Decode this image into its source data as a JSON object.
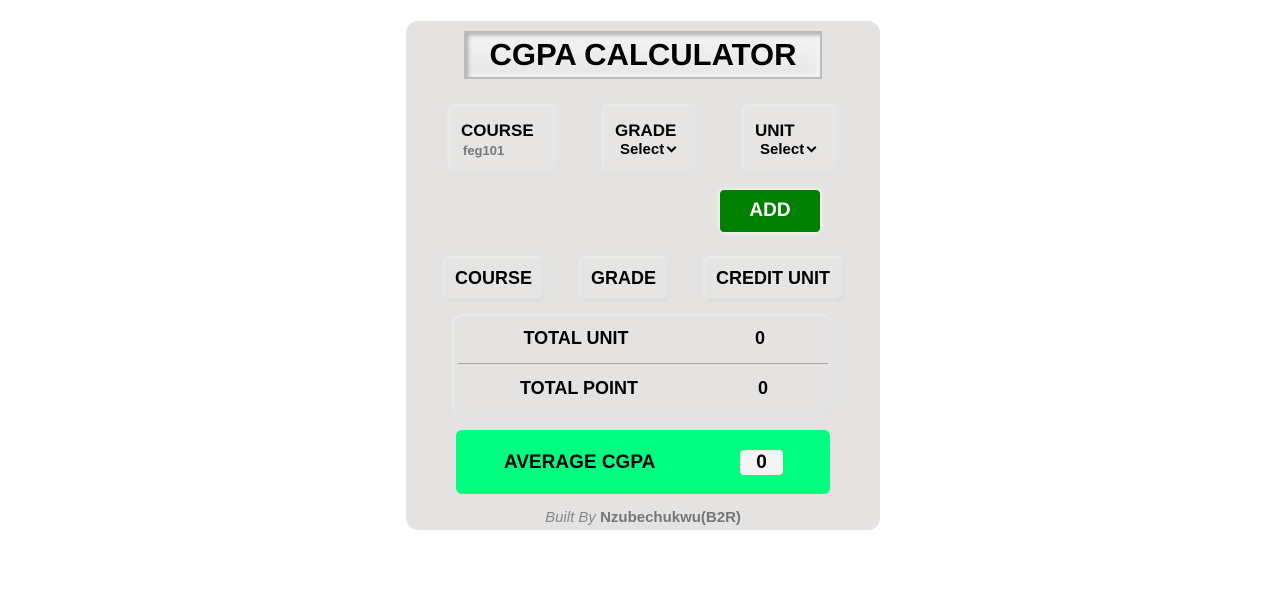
{
  "app": {
    "title": "CGPA CALCULATOR"
  },
  "form": {
    "course_label": "COURSE",
    "course_value": "feg101",
    "grade_label": "GRADE",
    "grade_selected": "Select",
    "unit_label": "UNIT",
    "unit_selected": "Select",
    "add_label": "ADD"
  },
  "table": {
    "columns": [
      "COURSE",
      "GRADE",
      "CREDIT UNIT"
    ]
  },
  "totals": {
    "total_unit_label": "TOTAL UNIT",
    "total_unit_value": "0",
    "total_point_label": "TOTAL POINT",
    "total_point_value": "0"
  },
  "result": {
    "label": "AVERAGE CGPA",
    "value": "0"
  },
  "footer": {
    "prefix": "Built By",
    "author": "Nzubechukwu(B2R)"
  },
  "colors": {
    "add_button": "#008000",
    "cgpa_banner": "#00ff80",
    "card_background": "#e4e3e2"
  }
}
